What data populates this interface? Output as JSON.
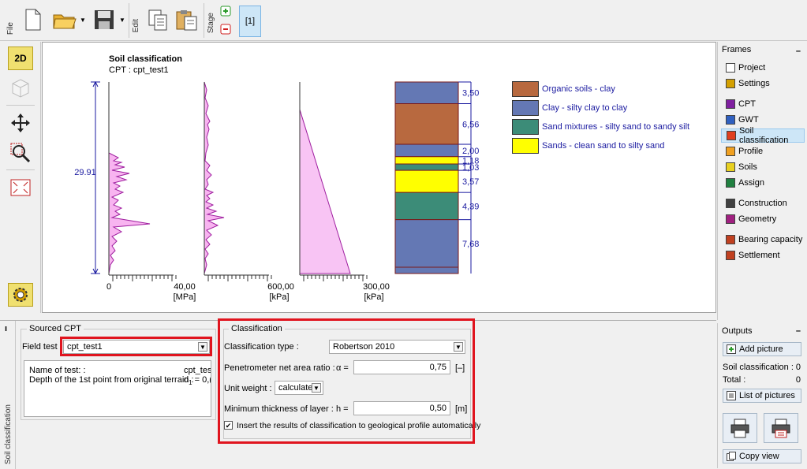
{
  "toolbar": {
    "file_label": "File",
    "edit_label": "Edit",
    "stage_label": "Stage",
    "stage_number": "[1]"
  },
  "leftbar": {
    "btn_2d": "2D",
    "btn_3d": "3D"
  },
  "chart_data": {
    "type": "line",
    "title": "Soil classification",
    "subtitle": "CPT : cpt_test1",
    "depth_label": "29.91",
    "panels": [
      {
        "axis_min": "0",
        "axis_max": "40,00",
        "unit": "[MPa]"
      },
      {
        "axis_min": "0",
        "axis_max": "600,00",
        "unit": "[kPa]"
      },
      {
        "axis_min": "0",
        "axis_max": "300,00",
        "unit": "[kPa]"
      }
    ],
    "layers": [
      {
        "thickness": "3,50",
        "value": 3.5,
        "type": "clay"
      },
      {
        "thickness": "6,56",
        "value": 6.56,
        "type": "organic"
      },
      {
        "thickness": "2,00",
        "value": 2.0,
        "type": "clay"
      },
      {
        "thickness": "1,18",
        "value": 1.18,
        "type": "sands"
      },
      {
        "thickness": "1,03",
        "value": 1.03,
        "type": "sandmix"
      },
      {
        "thickness": "3,57",
        "value": 3.57,
        "type": "sands"
      },
      {
        "thickness": "4,39",
        "value": 4.39,
        "type": "sandmix"
      },
      {
        "thickness": "7,68",
        "value": 7.68,
        "type": "clay"
      }
    ],
    "legend": [
      {
        "label": "Organic soils - clay",
        "color": "#b8693f"
      },
      {
        "label": "Clay - silty clay to clay",
        "color": "#6478b4"
      },
      {
        "label": "Sand mixtures - silty sand to sandy silt",
        "color": "#3c8c78"
      },
      {
        "label": "Sands - clean sand to silty sand",
        "color": "#ffff00"
      }
    ]
  },
  "frames": {
    "header": "Frames",
    "items": [
      {
        "label": "Project",
        "icon": "project-icon",
        "color": "#ffffff"
      },
      {
        "label": "Settings",
        "icon": "settings-gear-icon",
        "color": "#d4a000"
      },
      {
        "label": "CPT",
        "icon": "cpt-icon",
        "color": "#8020a0"
      },
      {
        "label": "GWT",
        "icon": "gwt-icon",
        "color": "#3060c0"
      },
      {
        "label": "Soil classification",
        "icon": "soil-classification-icon",
        "color": "#e04020"
      },
      {
        "label": "Profile",
        "icon": "profile-icon",
        "color": "#f0a020"
      },
      {
        "label": "Soils",
        "icon": "soils-icon",
        "color": "#e8d020"
      },
      {
        "label": "Assign",
        "icon": "assign-icon",
        "color": "#208040"
      },
      {
        "label": "Construction",
        "icon": "construction-icon",
        "color": "#404040"
      },
      {
        "label": "Geometry",
        "icon": "geometry-icon",
        "color": "#a02080"
      },
      {
        "label": "Bearing capacity",
        "icon": "bearing-capacity-icon",
        "color": "#c04020"
      },
      {
        "label": "Settlement",
        "icon": "settlement-icon",
        "color": "#c04020"
      }
    ]
  },
  "sourced": {
    "legend": "Sourced CPT",
    "field_test_label": "Field test :",
    "field_test_value": "cpt_test1",
    "info_name_label": "Name of test: :",
    "info_name_value": "cpt_tes",
    "info_depth_label": "Depth of the 1st point from original terrain :",
    "info_depth_symbol": "d",
    "info_depth_sub": "1",
    "info_depth_value": "= 0,("
  },
  "classification": {
    "legend": "Classification",
    "type_label": "Classification type :",
    "type_value": "Robertson 2010",
    "ratio_label": "Penetrometer net area ratio :",
    "ratio_symbol": "α =",
    "ratio_value": "0,75",
    "ratio_unit": "[–]",
    "weight_label": "Unit weight :",
    "weight_value": "calculate",
    "thickness_label": "Minimum thickness of layer :",
    "thickness_symbol": "h =",
    "thickness_value": "0,50",
    "thickness_unit": "[m]",
    "checkbox_label": "Insert the results of classification to geological profile automatically",
    "checkbox_mark": "✔"
  },
  "side_tab": "Soil classification",
  "outputs": {
    "header": "Outputs",
    "add_picture": "Add picture",
    "soil_class_label": "Soil classification :",
    "soil_class_count": "0",
    "total_label": "Total :",
    "total_count": "0",
    "list_pictures": "List of pictures",
    "copy_view": "Copy view"
  }
}
